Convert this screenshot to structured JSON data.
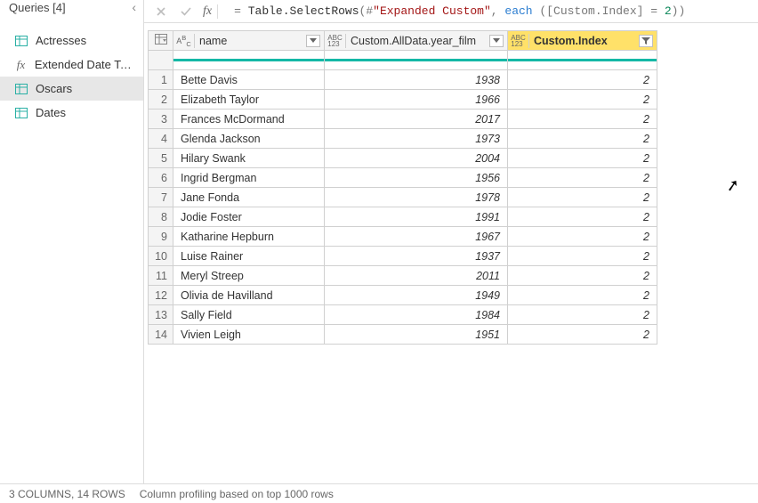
{
  "sidebar": {
    "title": "Queries [4]",
    "items": [
      {
        "label": "Actresses",
        "icon": "table"
      },
      {
        "label": "Extended Date Table",
        "icon": "fx"
      },
      {
        "label": "Oscars",
        "icon": "table",
        "selected": true
      },
      {
        "label": "Dates",
        "icon": "table"
      }
    ]
  },
  "formula": {
    "prefix": "= ",
    "fn": "Table.SelectRows",
    "open": "(#",
    "str": "\"Expanded Custom\"",
    "mid1": ", ",
    "kw": "each",
    "mid2": " ([Custom.Index] = ",
    "num": "2",
    "end": "))"
  },
  "columns": [
    {
      "key": "name",
      "label": "name",
      "type": "text"
    },
    {
      "key": "year",
      "label": "Custom.AllData.year_film",
      "type": "any"
    },
    {
      "key": "idx",
      "label": "Custom.Index",
      "type": "any",
      "filtered": true
    }
  ],
  "rows": [
    {
      "name": "Bette Davis",
      "year": 1938,
      "idx": 2
    },
    {
      "name": "Elizabeth Taylor",
      "year": 1966,
      "idx": 2
    },
    {
      "name": "Frances McDormand",
      "year": 2017,
      "idx": 2
    },
    {
      "name": "Glenda Jackson",
      "year": 1973,
      "idx": 2
    },
    {
      "name": "Hilary Swank",
      "year": 2004,
      "idx": 2
    },
    {
      "name": "Ingrid Bergman",
      "year": 1956,
      "idx": 2
    },
    {
      "name": "Jane Fonda",
      "year": 1978,
      "idx": 2
    },
    {
      "name": "Jodie Foster",
      "year": 1991,
      "idx": 2
    },
    {
      "name": "Katharine Hepburn",
      "year": 1967,
      "idx": 2
    },
    {
      "name": "Luise Rainer",
      "year": 1937,
      "idx": 2
    },
    {
      "name": "Meryl Streep",
      "year": 2011,
      "idx": 2
    },
    {
      "name": "Olivia de Havilland",
      "year": 1949,
      "idx": 2
    },
    {
      "name": "Sally Field",
      "year": 1984,
      "idx": 2
    },
    {
      "name": "Vivien Leigh",
      "year": 1951,
      "idx": 2
    }
  ],
  "status": {
    "summary": "3 COLUMNS, 14 ROWS",
    "profiling": "Column profiling based on top 1000 rows"
  }
}
